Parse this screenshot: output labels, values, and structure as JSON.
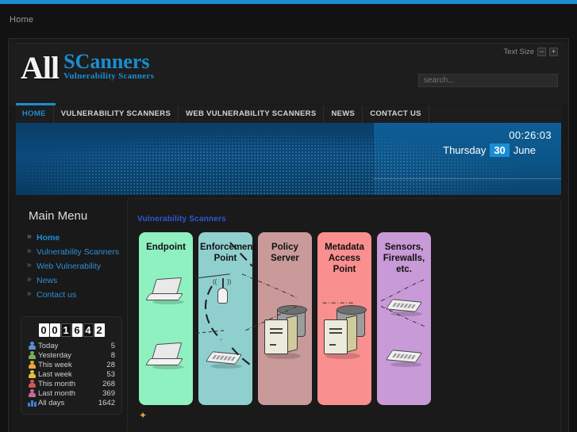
{
  "breadcrumb": {
    "label": "Home"
  },
  "header": {
    "text_size_label": "Text Size",
    "decrease_label": "−",
    "increase_label": "+",
    "logo_primary": "All",
    "logo_secondary": "SCanners",
    "logo_tagline": "Vulnerability  Scanners",
    "search_placeholder": "search..."
  },
  "nav": {
    "items": [
      {
        "label": "HOME",
        "active": true
      },
      {
        "label": "VULNERABILITY SCANNERS",
        "active": false
      },
      {
        "label": "WEB VULNERABILITY SCANNERS",
        "active": false
      },
      {
        "label": "NEWS",
        "active": false
      },
      {
        "label": "CONTACT US",
        "active": false
      }
    ]
  },
  "banner": {
    "time": "00:26:03",
    "weekday": "Thursday",
    "day": "30",
    "month": "June"
  },
  "sidebar": {
    "menu_title": "Main Menu",
    "menu_items": [
      {
        "label": "Home"
      },
      {
        "label": "Vulnerability Scanners"
      },
      {
        "label": "Web Vulnerability"
      },
      {
        "label": "News"
      },
      {
        "label": "Contact us"
      }
    ],
    "counter": {
      "digits": [
        "0",
        "0",
        "1",
        "6",
        "4",
        "2"
      ],
      "rows": [
        {
          "icon": "visitor-icon",
          "label": "Today",
          "value": "5",
          "color": "#5a8fd6"
        },
        {
          "icon": "visitor-icon",
          "label": "Yesterday",
          "value": "8",
          "color": "#7fae52"
        },
        {
          "icon": "visitor-icon",
          "label": "This week",
          "value": "28",
          "color": "#e8a63d"
        },
        {
          "icon": "visitor-icon",
          "label": "Last week",
          "value": "53",
          "color": "#e8c03d"
        },
        {
          "icon": "visitor-icon",
          "label": "This month",
          "value": "268",
          "color": "#d05a4a"
        },
        {
          "icon": "visitor-icon",
          "label": "Last month",
          "value": "369",
          "color": "#c46a9a"
        },
        {
          "icon": "bar-chart-icon",
          "label": "All days",
          "value": "1642",
          "color": "#3c7fd0"
        }
      ]
    }
  },
  "main": {
    "heading": "Vulnerability Scanners",
    "diagram": {
      "columns": [
        {
          "title": "Endpoint",
          "color": "#8ff0c0"
        },
        {
          "title": "Enforcement Point",
          "color": "#8fd0cf"
        },
        {
          "title": "Policy Server",
          "color": "#ca9a9a"
        },
        {
          "title": "Metadata Access Point",
          "color": "#f98f8f"
        },
        {
          "title": "Sensors, Firewalls, etc.",
          "color": "#c89ad8"
        }
      ]
    },
    "footer_icon": "star-icon"
  },
  "colors": {
    "accent": "#1a8ed1",
    "page_bg": "#111111",
    "panel_bg": "#1a1a1a",
    "heading_blue": "#2b59d8"
  }
}
